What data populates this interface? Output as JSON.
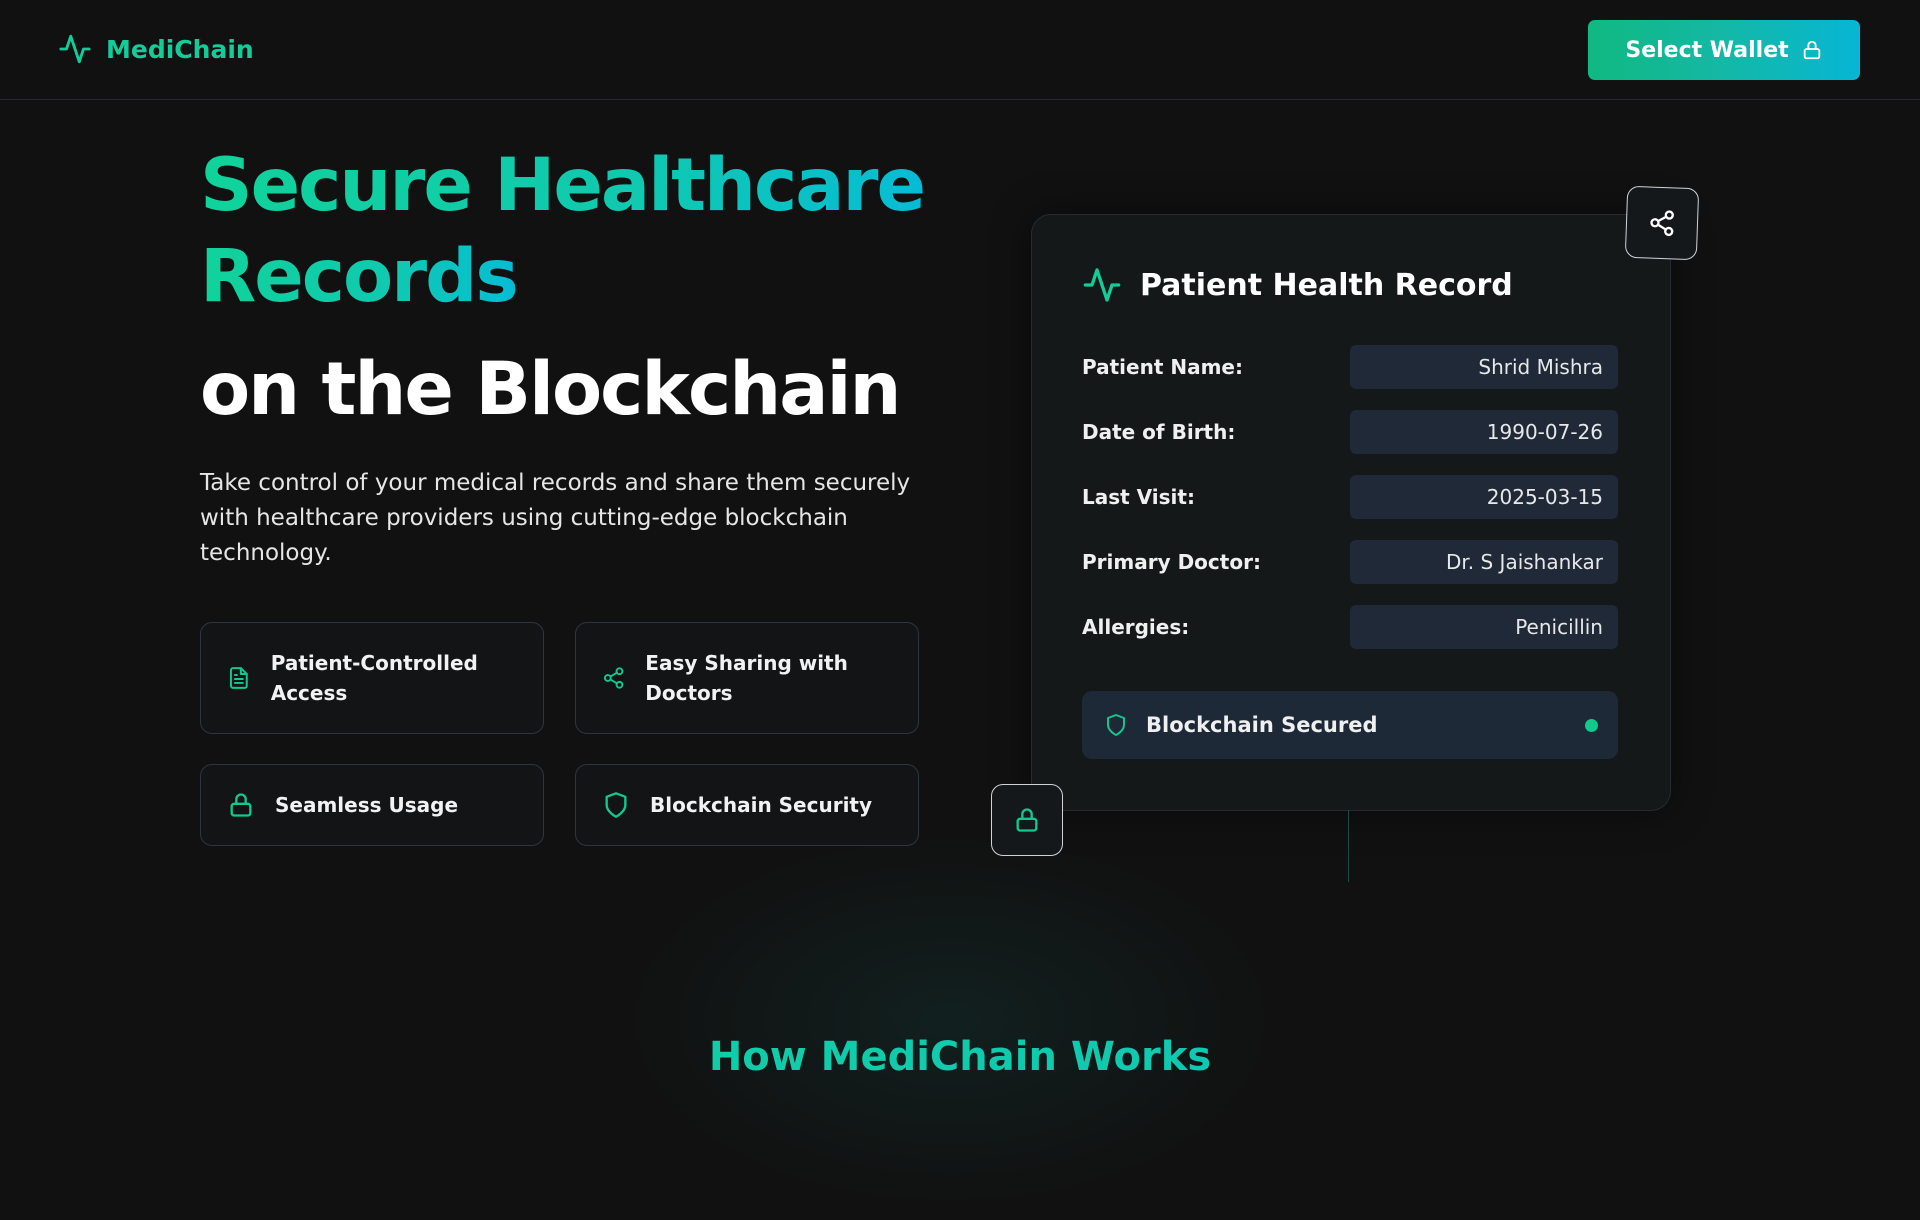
{
  "header": {
    "brand": "MediChain",
    "wallet_button": "Select Wallet"
  },
  "hero": {
    "title_line1": "Secure Healthcare",
    "title_line2": "Records",
    "title_line3": "on the Blockchain",
    "description": "Take control of your medical records and share them securely with healthcare providers using cutting-edge blockchain technology."
  },
  "features": [
    {
      "label": "Patient-Controlled Access",
      "icon": "document-icon"
    },
    {
      "label": "Easy Sharing with Doctors",
      "icon": "share-icon"
    },
    {
      "label": "Seamless Usage",
      "icon": "lock-icon"
    },
    {
      "label": "Blockchain Security",
      "icon": "shield-icon"
    }
  ],
  "record_card": {
    "title": "Patient Health Record",
    "rows": [
      {
        "label": "Patient Name:",
        "value": "Shrid Mishra"
      },
      {
        "label": "Date of Birth:",
        "value": "1990-07-26"
      },
      {
        "label": "Last Visit:",
        "value": "2025-03-15"
      },
      {
        "label": "Primary Doctor:",
        "value": "Dr. S Jaishankar"
      },
      {
        "label": "Allergies:",
        "value": "Penicillin"
      }
    ],
    "status": "Blockchain Secured"
  },
  "section": {
    "title": "How MediChain Works"
  },
  "colors": {
    "accent": "#10b981",
    "accent_cyan": "#06b6d4",
    "background": "#111111",
    "field_bg": "#1f2937"
  }
}
